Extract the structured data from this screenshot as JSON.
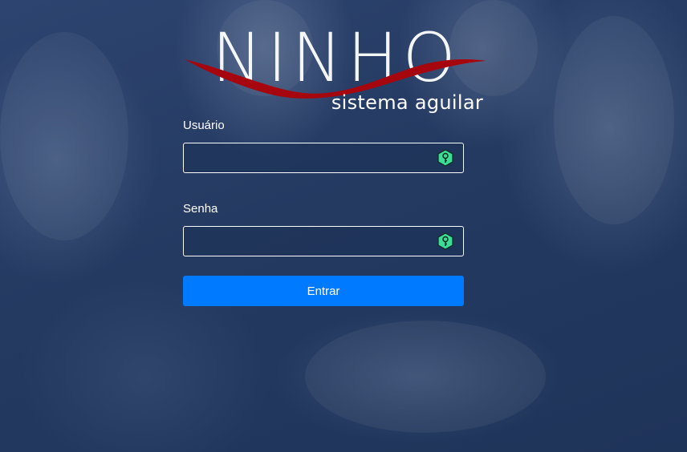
{
  "brand": {
    "wordmark": "NINHO",
    "subtitle": "sistema aguilar",
    "swoosh_color": "#a6060e"
  },
  "form": {
    "username": {
      "label": "Usuário",
      "value": "",
      "icon": "key-icon"
    },
    "password": {
      "label": "Senha",
      "value": "",
      "icon": "key-icon"
    },
    "submit_label": "Entrar",
    "submit_color": "#007bff",
    "icon_color": "#3ddc97"
  }
}
